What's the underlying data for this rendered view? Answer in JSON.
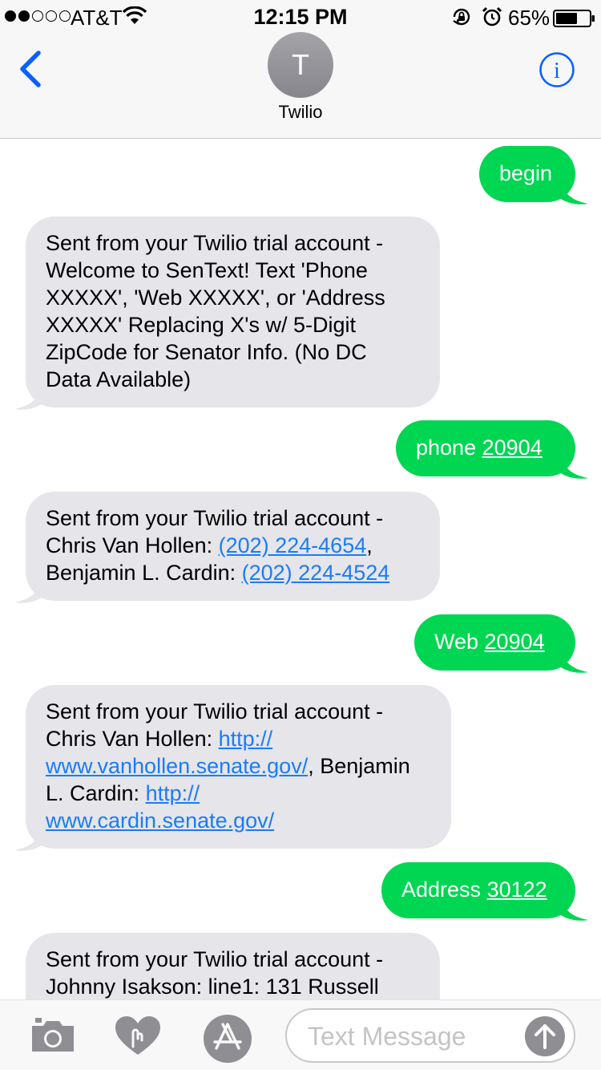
{
  "status_bar": {
    "carrier": "AT&T",
    "time": "12:15 PM",
    "battery": "65%",
    "battery_level": 0.65,
    "signal_bars_filled": 2,
    "signal_bars_total": 5,
    "icons": [
      "wifi-icon",
      "rotation-lock-icon",
      "alarm-icon",
      "battery-icon"
    ]
  },
  "nav": {
    "back_icon": "chevron-left-icon",
    "avatar_initial": "T",
    "contact_name": "Twilio",
    "info_icon": "info-icon"
  },
  "messages": [
    {
      "direction": "outgoing",
      "parts": [
        {
          "text": "begin",
          "link": false
        }
      ]
    },
    {
      "direction": "incoming",
      "parts": [
        {
          "text": "Sent from your Twilio trial account -\nWelcome to SenText! Text 'Phone\nXXXXX', 'Web XXXXX', or 'Address\nXXXXX' Replacing X's w/ 5-Digit\nZipCode for Senator Info. (No DC\nData Available)",
          "link": false
        }
      ]
    },
    {
      "direction": "outgoing",
      "parts": [
        {
          "text": "phone ",
          "link": false
        },
        {
          "text": "20904",
          "link": true
        }
      ]
    },
    {
      "direction": "incoming",
      "parts": [
        {
          "text": "Sent from your Twilio trial account -\nChris Van Hollen: ",
          "link": false
        },
        {
          "text": "(202) 224-4654",
          "link": true
        },
        {
          "text": ",\nBenjamin L. Cardin: ",
          "link": false
        },
        {
          "text": "(202) 224-4524",
          "link": true
        }
      ]
    },
    {
      "direction": "outgoing",
      "parts": [
        {
          "text": "Web ",
          "link": false
        },
        {
          "text": "20904",
          "link": true
        }
      ]
    },
    {
      "direction": "incoming",
      "parts": [
        {
          "text": "Sent from your Twilio trial account -\nChris Van Hollen: ",
          "link": false
        },
        {
          "text": "http://\nwww.vanhollen.senate.gov/",
          "link": true
        },
        {
          "text": ", Benjamin\nL. Cardin: ",
          "link": false
        },
        {
          "text": "http://\nwww.cardin.senate.gov/",
          "link": true
        }
      ]
    },
    {
      "direction": "outgoing",
      "parts": [
        {
          "text": "Address ",
          "link": false
        },
        {
          "text": "30122",
          "link": true
        }
      ]
    },
    {
      "direction": "incoming",
      "parts": [
        {
          "text": "Sent from your Twilio trial account -\nJohnny Isakson: line1: 131 Russell",
          "link": false
        }
      ]
    }
  ],
  "input_bar": {
    "camera_icon": "camera-icon",
    "digital_touch_icon": "digital-touch-heart-icon",
    "apps_icon": "app-store-icon",
    "placeholder": "Text Message",
    "value": "",
    "send_icon": "send-arrow-up-icon"
  },
  "colors": {
    "outgoing_bubble": "#00d652",
    "incoming_bubble": "#e5e5ea",
    "link_incoming": "#1a7cf7",
    "accent": "#0a60fe"
  }
}
